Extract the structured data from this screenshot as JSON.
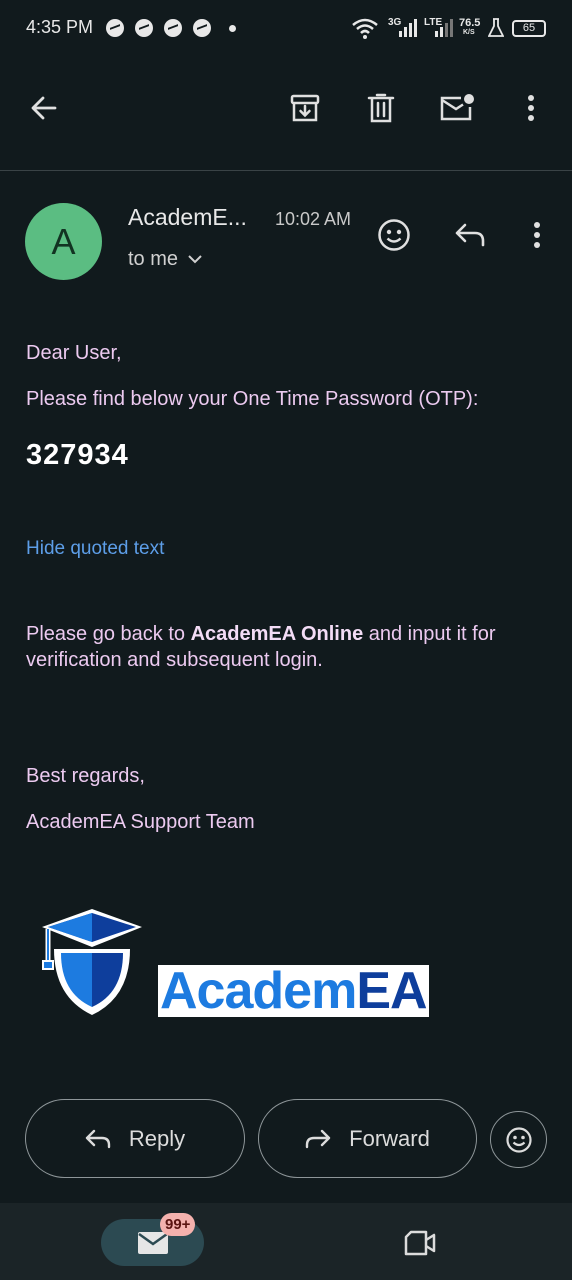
{
  "status_bar": {
    "time": "4:35 PM",
    "network_3g": "3G",
    "network_lte": "LTE",
    "speed_value": "76.5",
    "speed_unit": "K/S",
    "battery": "65"
  },
  "toolbar": {
    "back_icon": "arrow-left-icon",
    "archive_icon": "archive-icon",
    "delete_icon": "trash-icon",
    "mark_unread_icon": "mail-unread-icon",
    "more_icon": "more-vert-icon"
  },
  "email": {
    "avatar_letter": "A",
    "sender": "AcademE...",
    "time": "10:02 AM",
    "recipient": "to me",
    "greeting": "Dear User,",
    "otp_intro": "Please find below your One Time Password (OTP):",
    "otp_code": "327934",
    "hide_quoted": "Hide quoted text",
    "instruction_prefix": "Please go back to ",
    "instruction_bold": "AcademEA Online",
    "instruction_suffix": " and input it for verification and subsequent login.",
    "regards": "Best regards,",
    "signature": "AcademEA Support Team",
    "logo_text_part1": "Academ",
    "logo_text_part2": "EA"
  },
  "actions": {
    "reply_label": "Reply",
    "forward_label": "Forward"
  },
  "bottom_nav": {
    "mail_badge": "99+"
  },
  "colors": {
    "background": "#111a1d",
    "body_text": "#eccaf0",
    "link": "#5d9ee8",
    "avatar": "#5bbd82",
    "badge": "#f4b1ad"
  }
}
